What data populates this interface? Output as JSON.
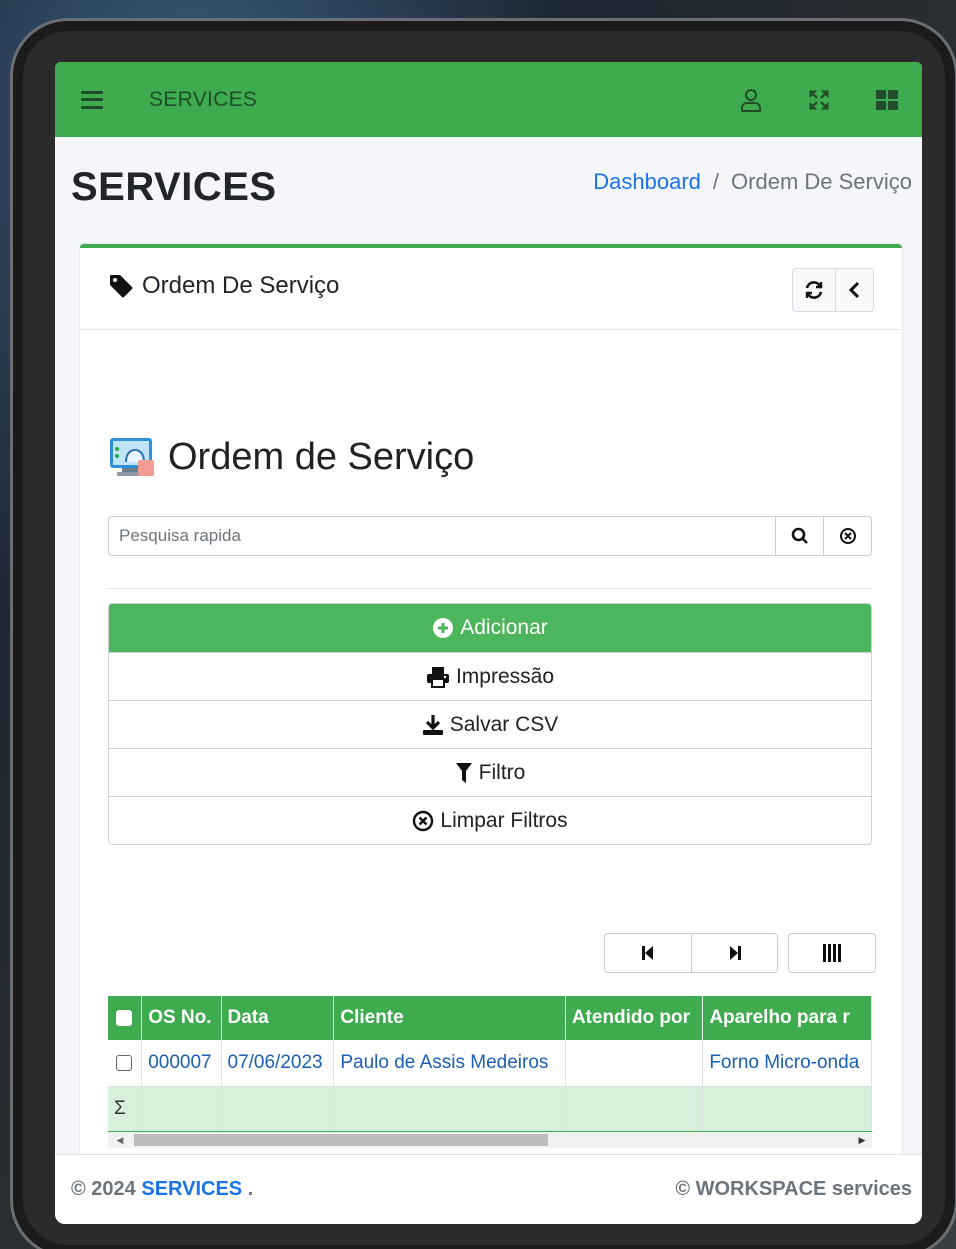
{
  "navbar": {
    "brand": "SERVICES",
    "icons": [
      "menu-icon",
      "user-icon",
      "fullscreen-icon",
      "apps-grid-icon"
    ],
    "color": "#3eab4f"
  },
  "header": {
    "title": "SERVICES",
    "breadcrumb": {
      "home": "Dashboard",
      "separator": "/",
      "current": "Ordem De Serviço"
    }
  },
  "card": {
    "title": "Ordem De Serviço",
    "app_title": "Ordem de Serviço",
    "search": {
      "placeholder": "Pesquisa rapida",
      "value": ""
    },
    "actions": {
      "add": "Adicionar",
      "print": "Impressão",
      "csv": "Salvar CSV",
      "filter": "Filtro",
      "clear": "Limpar Filtros"
    },
    "table": {
      "columns": [
        "OS No.",
        "Data",
        "Cliente",
        "Atendido por",
        "Aparelho para r"
      ],
      "rows": [
        {
          "os_no": "000007",
          "data": "07/06/2023",
          "cliente": "Paulo de Assis Medeiros",
          "atendido": "",
          "aparelho": "Forno Micro-onda"
        }
      ],
      "sum_symbol": "Σ"
    }
  },
  "footer": {
    "copyright_prefix": "© 2024",
    "brand": "SERVICES",
    "suffix": ".",
    "right": "© WORKSPACE services"
  }
}
